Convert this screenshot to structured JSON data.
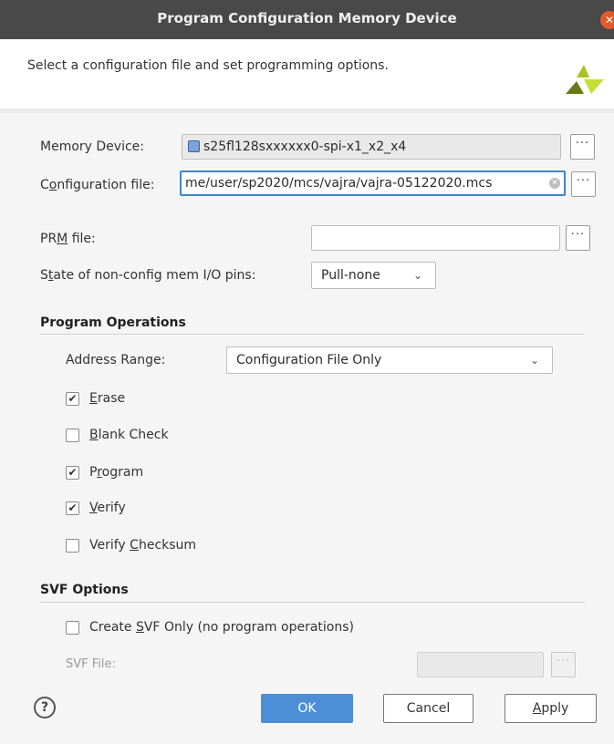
{
  "window": {
    "title": "Program Configuration Memory Device"
  },
  "header": {
    "subtitle": "Select a configuration file and set programming options."
  },
  "memory_device": {
    "label": "Memory Device:",
    "value": "s25fl128sxxxxxx0-spi-x1_x2_x4"
  },
  "config_file": {
    "label_pre": "C",
    "label_u": "o",
    "label_post": "nfiguration file:",
    "value": "me/user/sp2020/mcs/vajra/vajra-05122020.mcs"
  },
  "prm_file": {
    "label_pre": "PR",
    "label_u": "M",
    "label_post": " file:",
    "value": ""
  },
  "state_pins": {
    "label_pre": "S",
    "label_u": "t",
    "label_post": "ate of non-config mem I/O pins:",
    "value": "Pull-none"
  },
  "program_operations": {
    "title": "Program Operations",
    "address_range_label": "Address Range:",
    "address_range_value": "Configuration File Only",
    "options": [
      {
        "u": "E",
        "rest": "rase",
        "pre": "",
        "checked": true
      },
      {
        "u": "B",
        "rest": "lank Check",
        "pre": "",
        "checked": false
      },
      {
        "u": "r",
        "rest": "ogram",
        "pre": "P",
        "checked": true
      },
      {
        "u": "V",
        "rest": "erify",
        "pre": "",
        "checked": true
      },
      {
        "u": "C",
        "rest": "hecksum",
        "pre": "Verify ",
        "checked": false
      }
    ]
  },
  "svf_options": {
    "title": "SVF Options",
    "create_pre": "Create ",
    "create_u": "S",
    "create_post": "VF Only (no program operations)",
    "create_checked": false,
    "svf_file_label": "SVF File:",
    "svf_file_value": ""
  },
  "buttons": {
    "help": "?",
    "ok": "OK",
    "cancel": "Cancel",
    "apply_u": "A",
    "apply_rest": "pply",
    "browse": "···"
  },
  "colors": {
    "titlebar": "#494949",
    "accent": "#4d8fd6",
    "close": "#e25a2a"
  }
}
